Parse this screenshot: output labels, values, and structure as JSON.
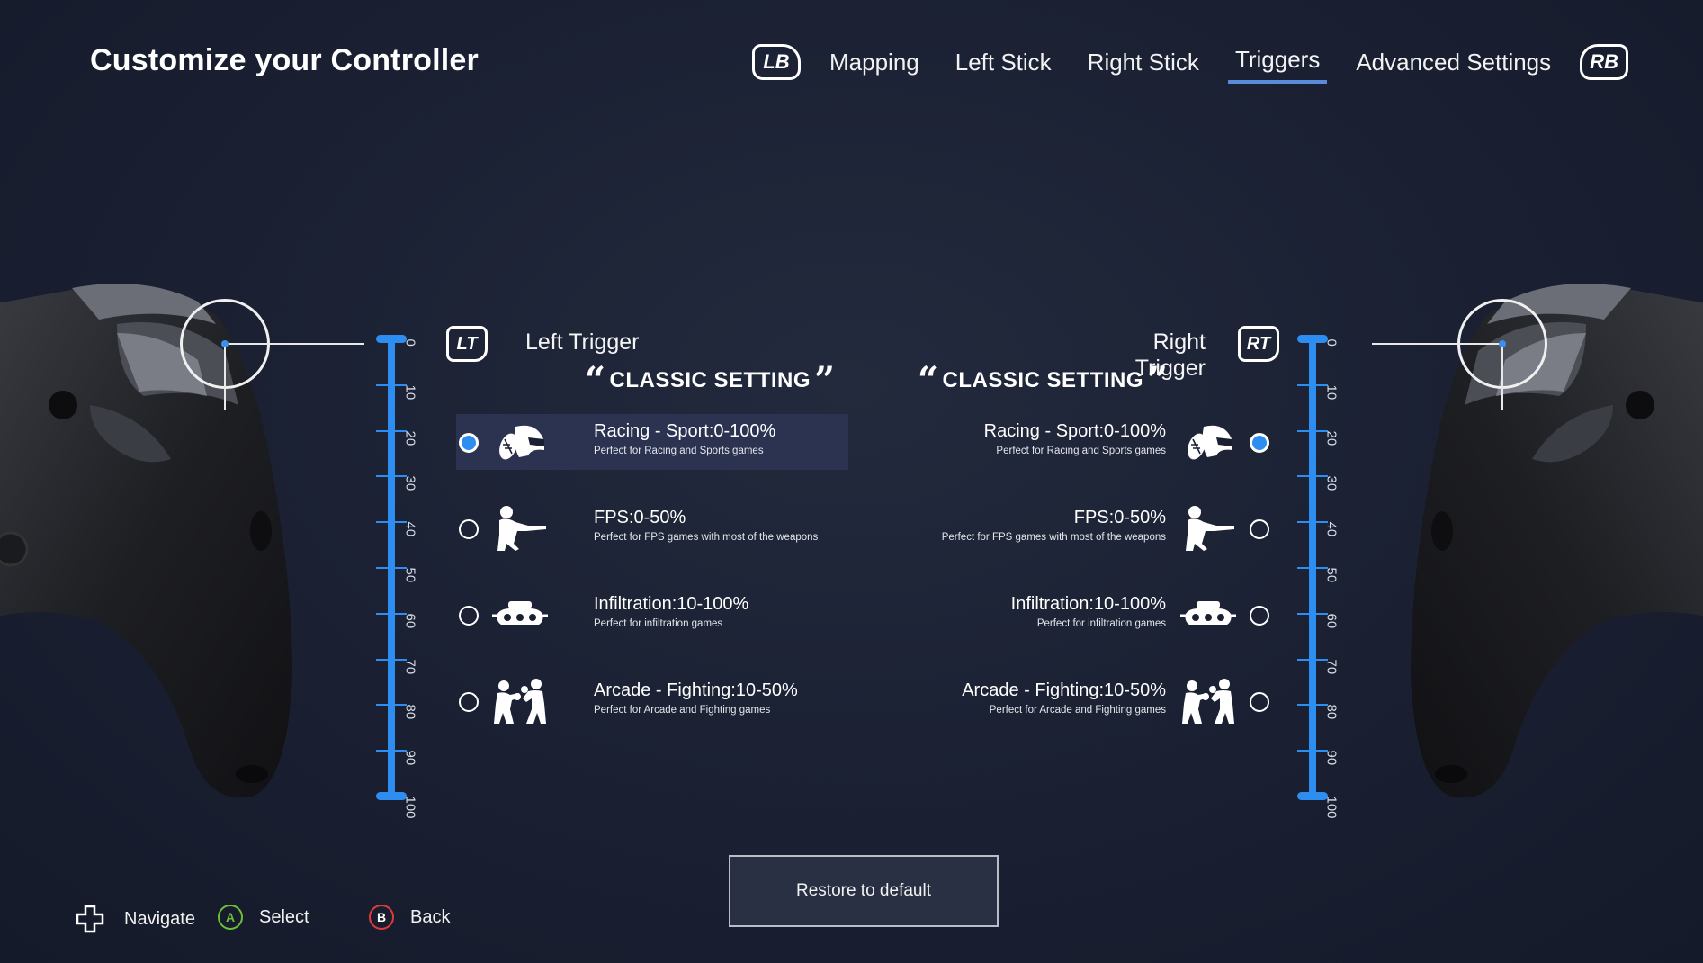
{
  "header": {
    "title": "Customize your Controller",
    "lb_label": "LB",
    "rb_label": "RB",
    "tabs": [
      {
        "label": "Mapping"
      },
      {
        "label": "Left Stick"
      },
      {
        "label": "Right Stick"
      },
      {
        "label": "Triggers"
      },
      {
        "label": "Advanced Settings"
      }
    ],
    "active_tab": "Triggers"
  },
  "colors": {
    "accent": "#2e8df0",
    "selected_row": "#2b3350",
    "select_button": "#6bbf3a",
    "back_button": "#e23a3a"
  },
  "scale_ticks": [
    "0",
    "10",
    "20",
    "30",
    "40",
    "50",
    "60",
    "70",
    "80",
    "90",
    "100"
  ],
  "left_trigger": {
    "icon_label": "LT",
    "title": "Left Trigger",
    "section": "CLASSIC SETTING",
    "options": [
      {
        "name": "Racing - Sport:0-100%",
        "desc": "Perfect for Racing and Sports games",
        "selected": true,
        "icon": "helmet-football-icon"
      },
      {
        "name": "FPS:0-50%",
        "desc": "Perfect for FPS games with most of the weapons",
        "selected": false,
        "icon": "shooter-icon"
      },
      {
        "name": "Infiltration:10-100%",
        "desc": "Perfect for infiltration games",
        "selected": false,
        "icon": "night-vision-goggles-icon"
      },
      {
        "name": "Arcade - Fighting:10-50%",
        "desc": "Perfect for Arcade and Fighting games",
        "selected": false,
        "icon": "fighters-icon"
      }
    ]
  },
  "right_trigger": {
    "icon_label": "RT",
    "title": "Right Trigger",
    "section": "CLASSIC SETTING",
    "options": [
      {
        "name": "Racing - Sport:0-100%",
        "desc": "Perfect for Racing and Sports games",
        "selected": true,
        "icon": "helmet-football-icon"
      },
      {
        "name": "FPS:0-50%",
        "desc": "Perfect for FPS games with most of the weapons",
        "selected": false,
        "icon": "shooter-icon"
      },
      {
        "name": "Infiltration:10-100%",
        "desc": "Perfect for infiltration games",
        "selected": false,
        "icon": "night-vision-goggles-icon"
      },
      {
        "name": "Arcade - Fighting:10-50%",
        "desc": "Perfect for Arcade and Fighting games",
        "selected": false,
        "icon": "fighters-icon"
      }
    ]
  },
  "restore_label": "Restore to default",
  "footer": {
    "navigate": "Navigate",
    "select": "Select",
    "select_key": "A",
    "back": "Back",
    "back_key": "B"
  }
}
